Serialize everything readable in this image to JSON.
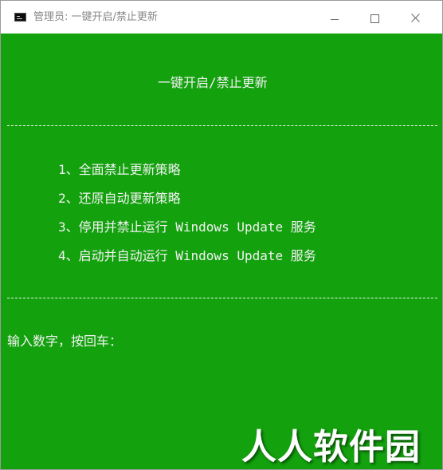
{
  "window": {
    "title": "管理员:  一键开启/禁止更新",
    "icon": "console-icon",
    "controls": [
      "minimize-icon",
      "maximize-icon",
      "close-icon"
    ]
  },
  "console": {
    "background": "#13a10e",
    "foreground": "#f2f2f2",
    "heading": "一键开启/禁止更新",
    "menu": [
      "1、全面禁止更新策略",
      "2、还原自动更新策略",
      "3、停用并禁止运行 Windows Update 服务",
      "4、启动并自动运行 Windows Update 服务"
    ],
    "prompt": "输入数字，按回车："
  },
  "watermark": {
    "text": "人人软件园"
  }
}
